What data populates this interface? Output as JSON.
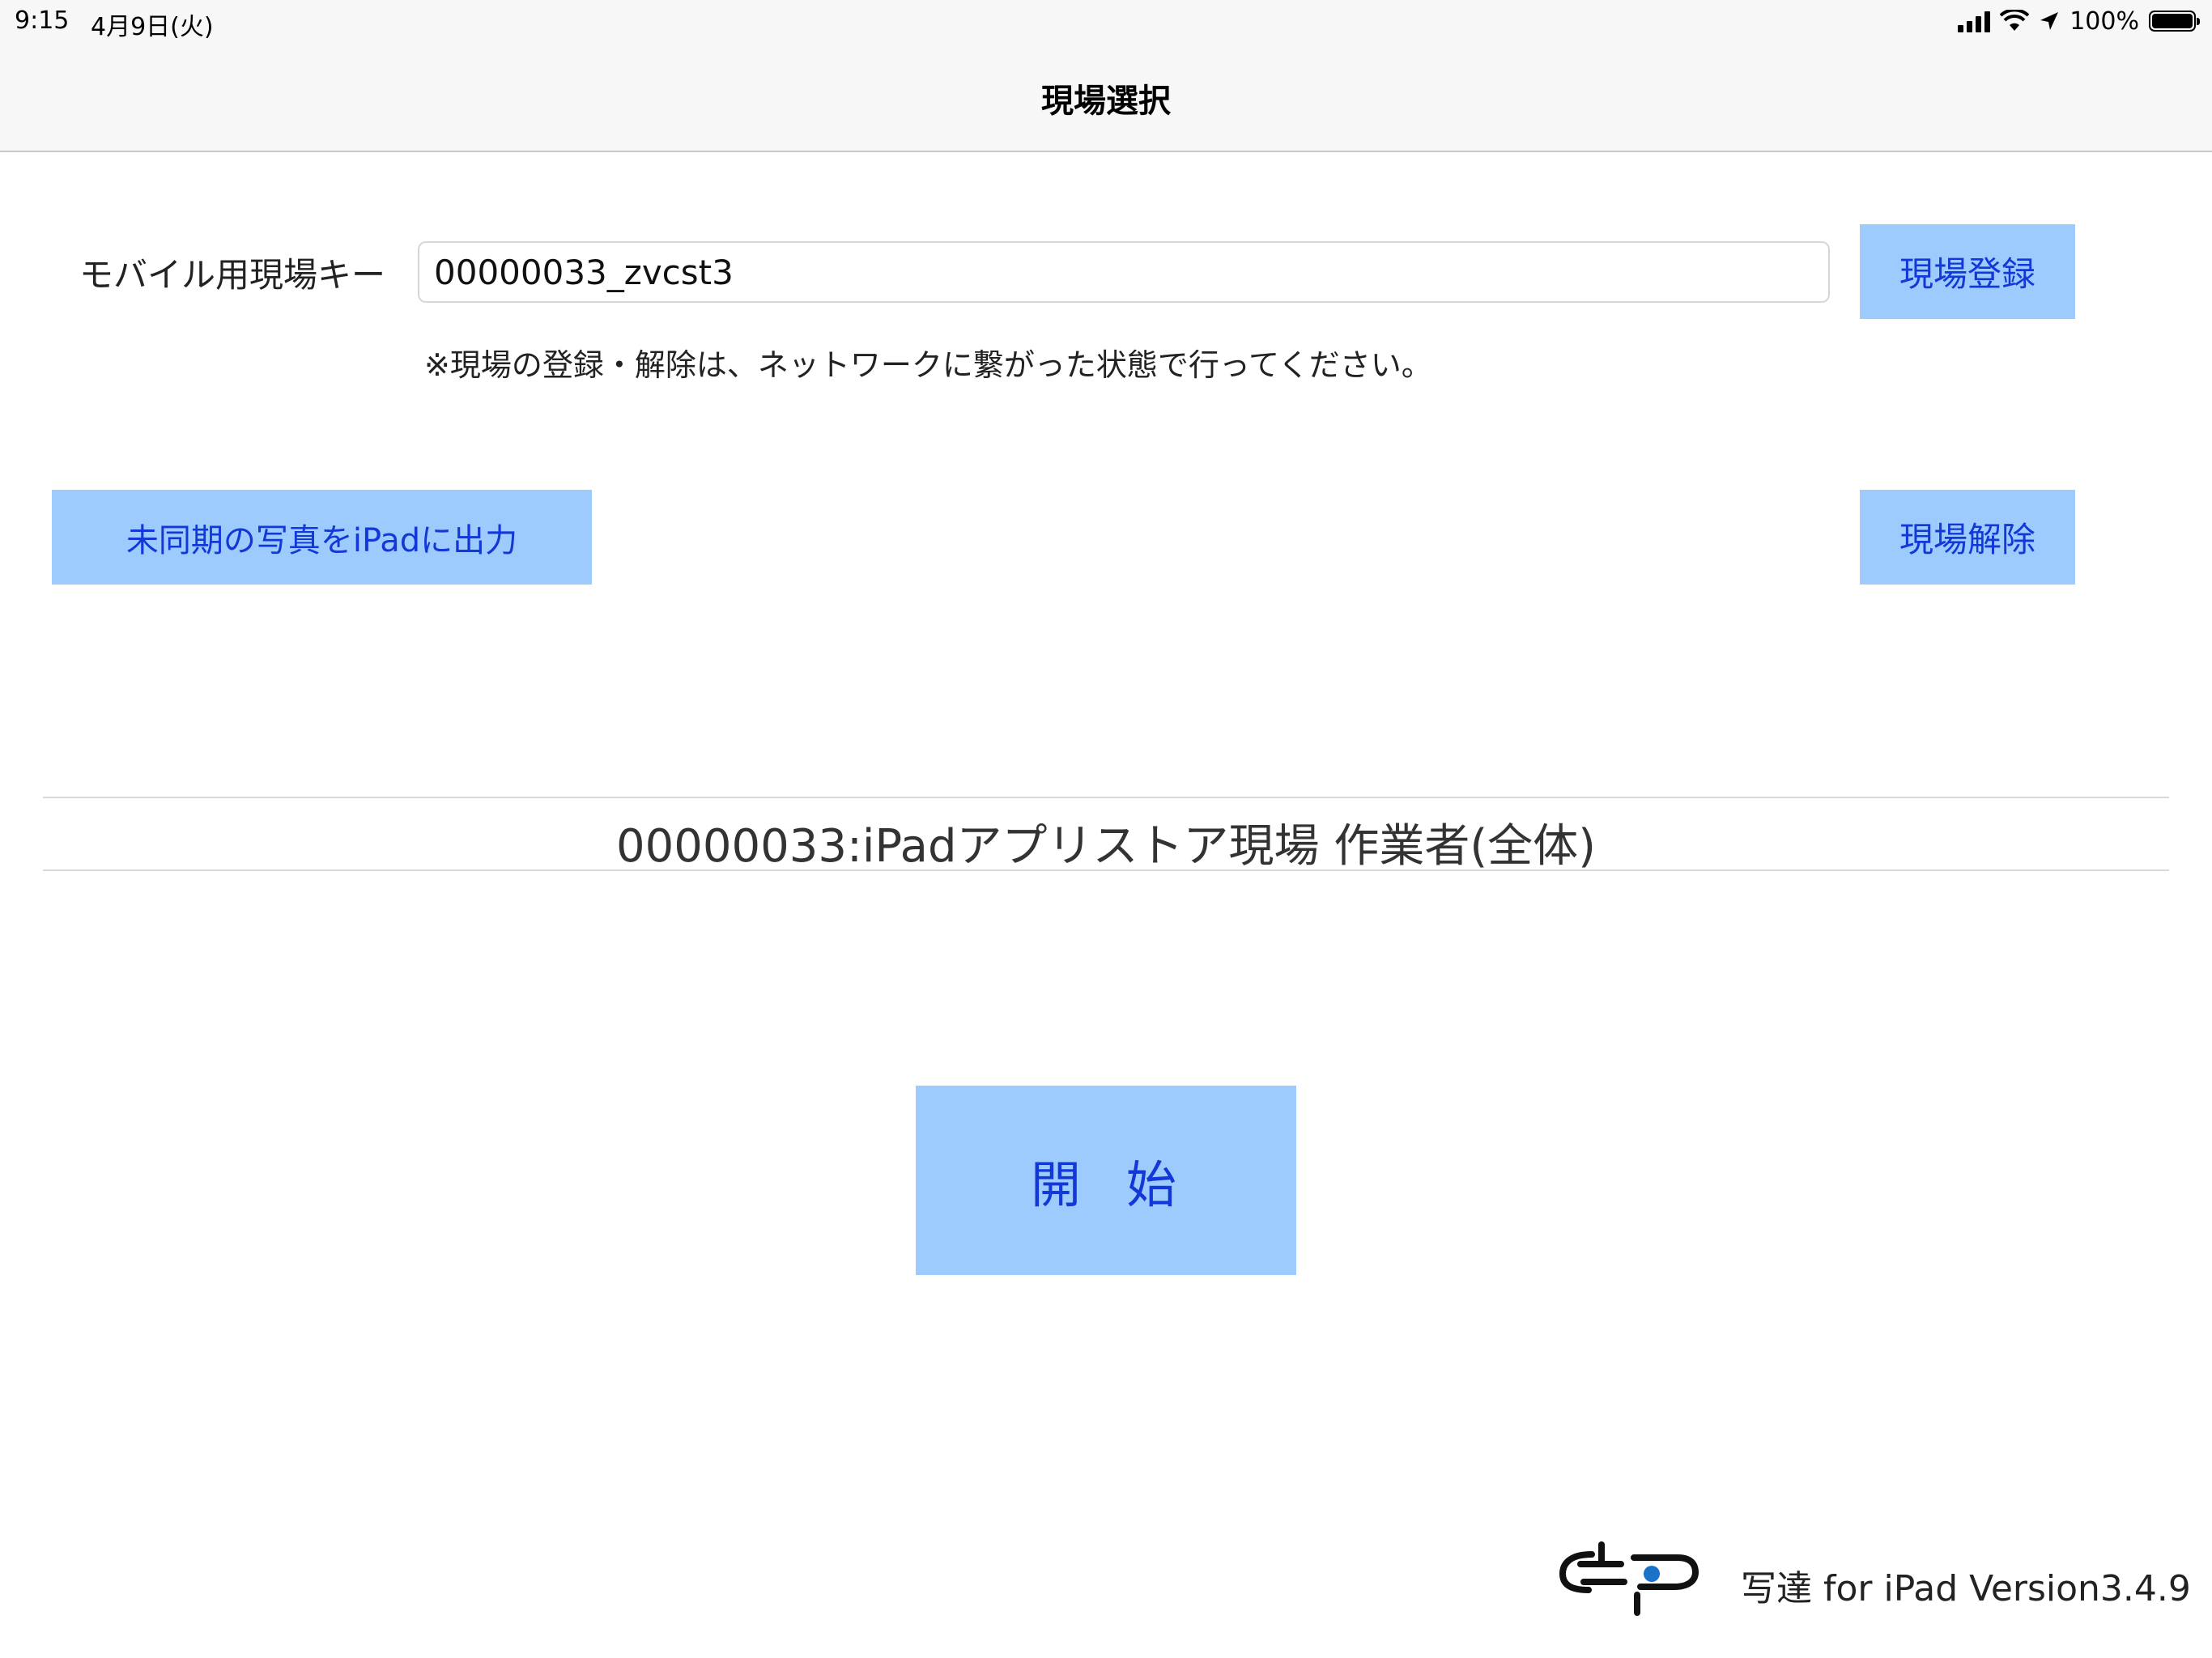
{
  "status_bar": {
    "time": "9:15",
    "date": "4月9日(火)",
    "battery": "100%",
    "battery_level": 1.0,
    "icons": [
      "signal-icon",
      "wifi-icon",
      "location-arrow-icon",
      "battery-icon"
    ]
  },
  "nav": {
    "title": "現場選択"
  },
  "site_key": {
    "label": "モバイル用現場キー",
    "value": "00000033_zvcst3",
    "register_label": "現場登録"
  },
  "note": "※現場の登録・解除は、ネットワークに繋がった状態で行ってください。",
  "actions": {
    "export_label": "未同期の写真をiPadに出力",
    "release_label": "現場解除"
  },
  "current_site": "00000033:iPadアプリストア現場 作業者(全体)",
  "start_label": "開始",
  "footer": {
    "version": "写達 for iPad Version3.4.9",
    "logo": "dcp-logo"
  },
  "colors": {
    "button_bg": "#9ecbfd",
    "button_text": "#1338d8",
    "logo_dot": "#1a73c9"
  }
}
